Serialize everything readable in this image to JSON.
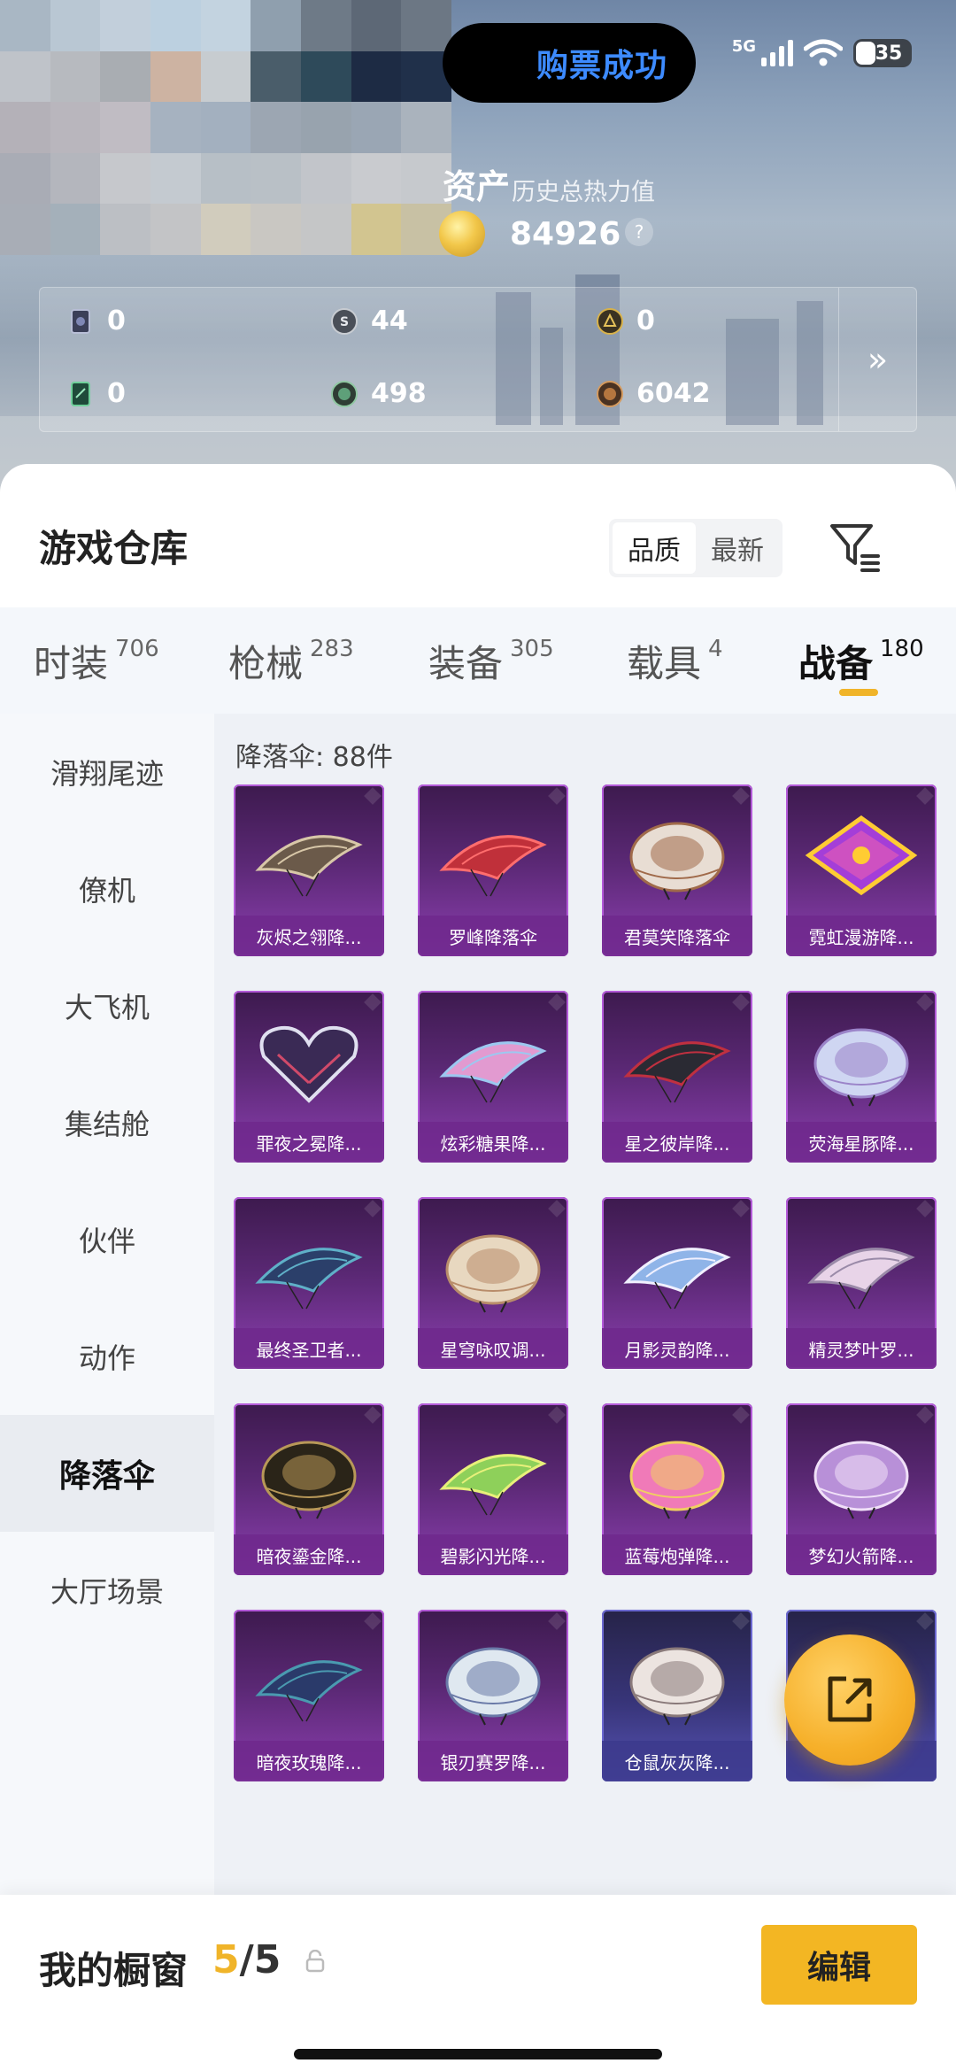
{
  "status_bar": {
    "pill_text": "购票成功",
    "network": "5G",
    "battery": "35"
  },
  "assets": {
    "title": "资产",
    "subtitle": "历史总热力值",
    "value": "84926",
    "help": "?",
    "stats": [
      {
        "icon": "card-icon",
        "value": "0"
      },
      {
        "icon": "silver-coin-icon",
        "value": "44"
      },
      {
        "icon": "gold-badge-icon",
        "value": "0"
      },
      {
        "icon": "green-card-icon",
        "value": "0"
      },
      {
        "icon": "green-coin-icon",
        "value": "498"
      },
      {
        "icon": "bronze-coin-icon",
        "value": "6042"
      }
    ],
    "more": "»"
  },
  "warehouse": {
    "title": "游戏仓库",
    "sort_options": [
      "品质",
      "最新"
    ],
    "active_sort": "品质"
  },
  "tabs": [
    {
      "label": "时装",
      "count": "706"
    },
    {
      "label": "枪械",
      "count": "283"
    },
    {
      "label": "装备",
      "count": "305"
    },
    {
      "label": "载具",
      "count": "4"
    },
    {
      "label": "战备",
      "count": "180",
      "active": true
    }
  ],
  "sidebar": [
    {
      "label": "滑翔尾迹"
    },
    {
      "label": "僚机"
    },
    {
      "label": "大飞机"
    },
    {
      "label": "集结舱"
    },
    {
      "label": "伙伴"
    },
    {
      "label": "动作"
    },
    {
      "label": "降落伞",
      "active": true
    },
    {
      "label": "大厅场景"
    }
  ],
  "content": {
    "count_label": "降落伞: 88件",
    "items": [
      {
        "name": "灰烬之翎降...",
        "tier": "purple"
      },
      {
        "name": "罗峰降落伞",
        "tier": "purple"
      },
      {
        "name": "君莫笑降落伞",
        "tier": "purple"
      },
      {
        "name": "霓虹漫游降...",
        "tier": "purple"
      },
      {
        "name": "罪夜之冕降...",
        "tier": "purple"
      },
      {
        "name": "炫彩糖果降...",
        "tier": "purple"
      },
      {
        "name": "星之彼岸降...",
        "tier": "purple"
      },
      {
        "name": "荧海星豚降...",
        "tier": "purple"
      },
      {
        "name": "最终圣卫者...",
        "tier": "purple"
      },
      {
        "name": "星穹咏叹调...",
        "tier": "purple"
      },
      {
        "name": "月影灵韵降...",
        "tier": "purple"
      },
      {
        "name": "精灵梦叶罗...",
        "tier": "purple"
      },
      {
        "name": "暗夜鎏金降...",
        "tier": "purple"
      },
      {
        "name": "碧影闪光降...",
        "tier": "purple"
      },
      {
        "name": "蓝莓炮弹降...",
        "tier": "purple"
      },
      {
        "name": "梦幻火箭降...",
        "tier": "purple"
      },
      {
        "name": "暗夜玫瑰降...",
        "tier": "purple"
      },
      {
        "name": "银刃赛罗降...",
        "tier": "purple"
      },
      {
        "name": "仓鼠灰灰降...",
        "tier": "blue"
      },
      {
        "name": "",
        "tier": "blue"
      }
    ]
  },
  "showcase": {
    "title": "我的橱窗",
    "current": "5",
    "separator": "/",
    "max": "5",
    "edit_label": "编辑"
  },
  "colors": {
    "accent": "#f3b623",
    "purple_card": "#8c3fb0",
    "blue_card": "#5754b5",
    "status_pill_text": "#3d8bff"
  }
}
